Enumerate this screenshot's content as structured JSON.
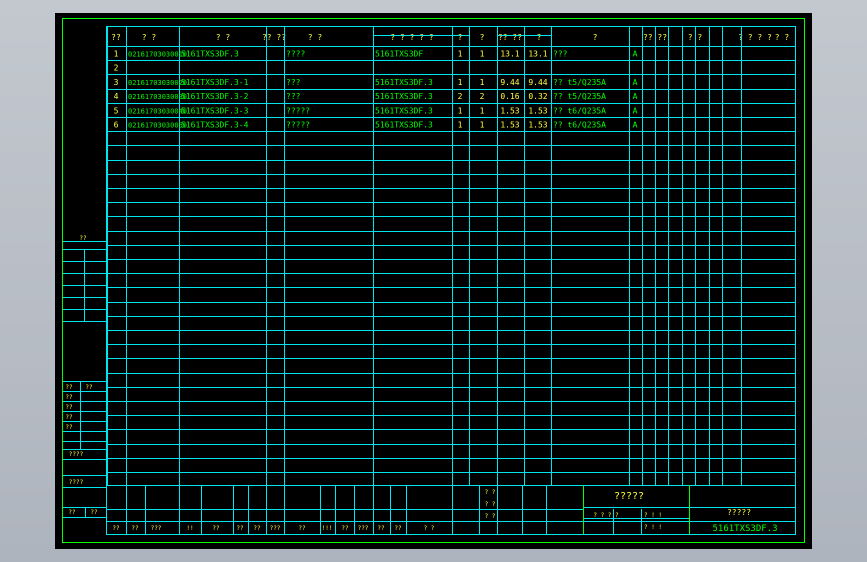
{
  "header": [
    "??",
    "? ?",
    "? ?",
    "?? ??",
    "? ?",
    "? ? ? ? ?",
    "?",
    "?",
    "?? ??",
    "?",
    "?",
    "?? ??",
    "? ?",
    "? ? ? ?",
    "? ?"
  ],
  "rows": [
    {
      "no": "1",
      "code": "02161703030010",
      "drawing": "5161TXS3DF.3",
      "name": "????",
      "material": "5161TXS3DF",
      "q1": "1",
      "q2": "1",
      "w1": "13.1",
      "w2": "13.1",
      "spec": "???",
      "mark": "A"
    },
    {
      "no": "2",
      "code": "",
      "drawing": "",
      "name": "",
      "material": "",
      "q1": "",
      "q2": "",
      "w1": "",
      "w2": "",
      "spec": "",
      "mark": ""
    },
    {
      "no": "3",
      "code": "02161703030020",
      "drawing": "5161TXS3DF.3-1",
      "name": "???",
      "material": "5161TXS3DF.3",
      "q1": "1",
      "q2": "1",
      "w1": "9.44",
      "w2": "9.44",
      "spec": "?? t5/Q235A",
      "mark": "A"
    },
    {
      "no": "4",
      "code": "02161703030030",
      "drawing": "5161TXS3DF.3-2",
      "name": "???",
      "material": "5161TXS3DF.3",
      "q1": "2",
      "q2": "2",
      "w1": "0.16",
      "w2": "0.32",
      "spec": "?? t5/Q235A",
      "mark": "A"
    },
    {
      "no": "5",
      "code": "02161703030040",
      "drawing": "5161TXS3DF.3-3",
      "name": "?????",
      "material": "5161TXS3DF.3",
      "q1": "1",
      "q2": "1",
      "w1": "1.53",
      "w2": "1.53",
      "spec": "?? t6/Q235A",
      "mark": "A"
    },
    {
      "no": "6",
      "code": "02161703030050",
      "drawing": "5161TXS3DF.3-4",
      "name": "?????",
      "material": "5161TXS3DF.3",
      "q1": "1",
      "q2": "1",
      "w1": "1.53",
      "w2": "1.53",
      "spec": "?? t6/Q235A",
      "mark": "A"
    }
  ],
  "side": {
    "top_label": "??",
    "labels_a": [
      "??",
      "??",
      "??",
      "??",
      "??"
    ],
    "label_b": "????",
    "label_c": "????",
    "labels_d": [
      "??",
      "??"
    ]
  },
  "footer": {
    "bottom_labels": [
      "??",
      "??",
      "???",
      "!!",
      "??",
      "??",
      "??",
      "???",
      "??",
      "!!!",
      "??",
      "???",
      "??",
      "??",
      "? ?"
    ],
    "right_labels": [
      "? ?",
      "? ?",
      "? ?"
    ],
    "title_big": "?????",
    "title_mid": "?????",
    "small_a": "? ? ? ?",
    "small_b": "?  ! !",
    "small_c": "?  ! !",
    "drawing_no": "5161TXS3DF.3"
  },
  "colors": {
    "frame": "#00ff00",
    "grid": "#00e5ee",
    "text": "#00ff00",
    "yellow": "#ffff40",
    "background": "#000000"
  }
}
